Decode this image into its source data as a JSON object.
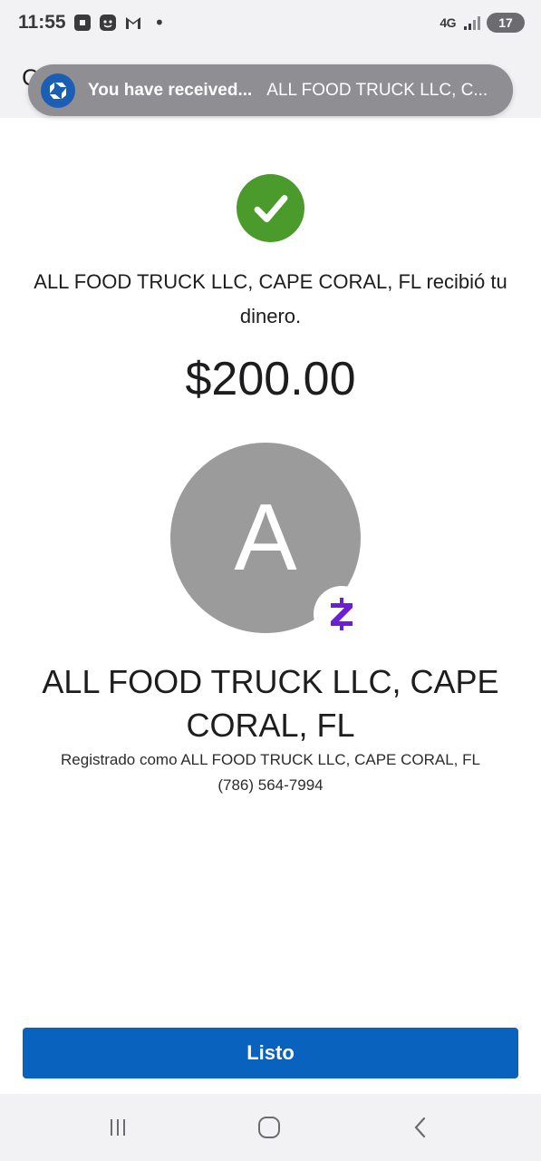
{
  "status_bar": {
    "time": "11:55",
    "network": "4G",
    "battery": "17",
    "icons": [
      "chase-icon",
      "app-icon",
      "gmail-icon"
    ],
    "dot": "•"
  },
  "header": {
    "partial_glyph": "C"
  },
  "notification": {
    "title": "You have received...",
    "body": "ALL FOOD TRUCK LLC, C..."
  },
  "main": {
    "message": "ALL FOOD TRUCK LLC, CAPE CORAL, FL recibió tu dinero.",
    "amount": "$200.00",
    "avatar_letter": "A",
    "recipient_name": "ALL FOOD TRUCK LLC, CAPE CORAL, FL",
    "registered_as": "Registrado como ALL FOOD TRUCK LLC, CAPE CORAL, FL",
    "phone": "(786) 564-7994"
  },
  "actions": {
    "done_label": "Listo"
  },
  "colors": {
    "success": "#4a9a2c",
    "primary": "#0a62bf",
    "zelle": "#6d1ed4",
    "avatar_bg": "#9b9b9b"
  }
}
